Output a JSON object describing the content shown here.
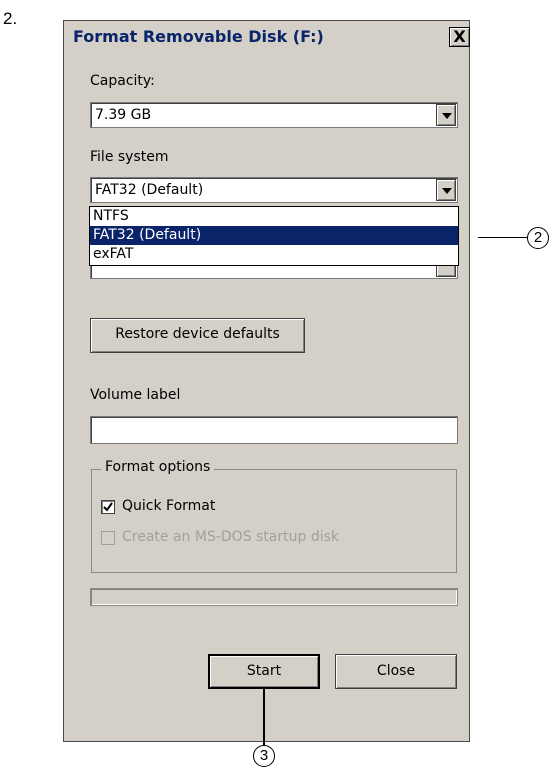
{
  "step_number": "2.",
  "dialog": {
    "title": "Format Removable Disk (F:)",
    "close_glyph": "X",
    "capacity": {
      "label": "Capacity:",
      "value": "7.39 GB"
    },
    "file_system": {
      "label": "File system",
      "value": "FAT32 (Default)",
      "options": [
        "NTFS",
        "FAT32 (Default)",
        "exFAT"
      ],
      "highlighted_option": "FAT32 (Default)"
    },
    "restore_button": "Restore device defaults",
    "volume_label": {
      "label": "Volume label",
      "value": ""
    },
    "format_options": {
      "title": "Format options",
      "quick_format": {
        "label": "Quick Format",
        "checked": true
      },
      "ms_dos": {
        "label": "Create an MS-DOS startup disk",
        "checked": false,
        "disabled": true
      }
    },
    "progress": 0,
    "start_button": "Start",
    "close_button": "Close"
  },
  "callouts": {
    "dropdown_callout": "2",
    "start_callout": "3"
  },
  "colors": {
    "dialog_bg": "#d4d0c8",
    "title_text": "#0a246a",
    "selection": "#0a246a",
    "disabled_text": "#a0a0a0"
  },
  "icons": {
    "close": "close-icon",
    "dropdown": "chevron-down-icon",
    "check": "check-icon"
  }
}
